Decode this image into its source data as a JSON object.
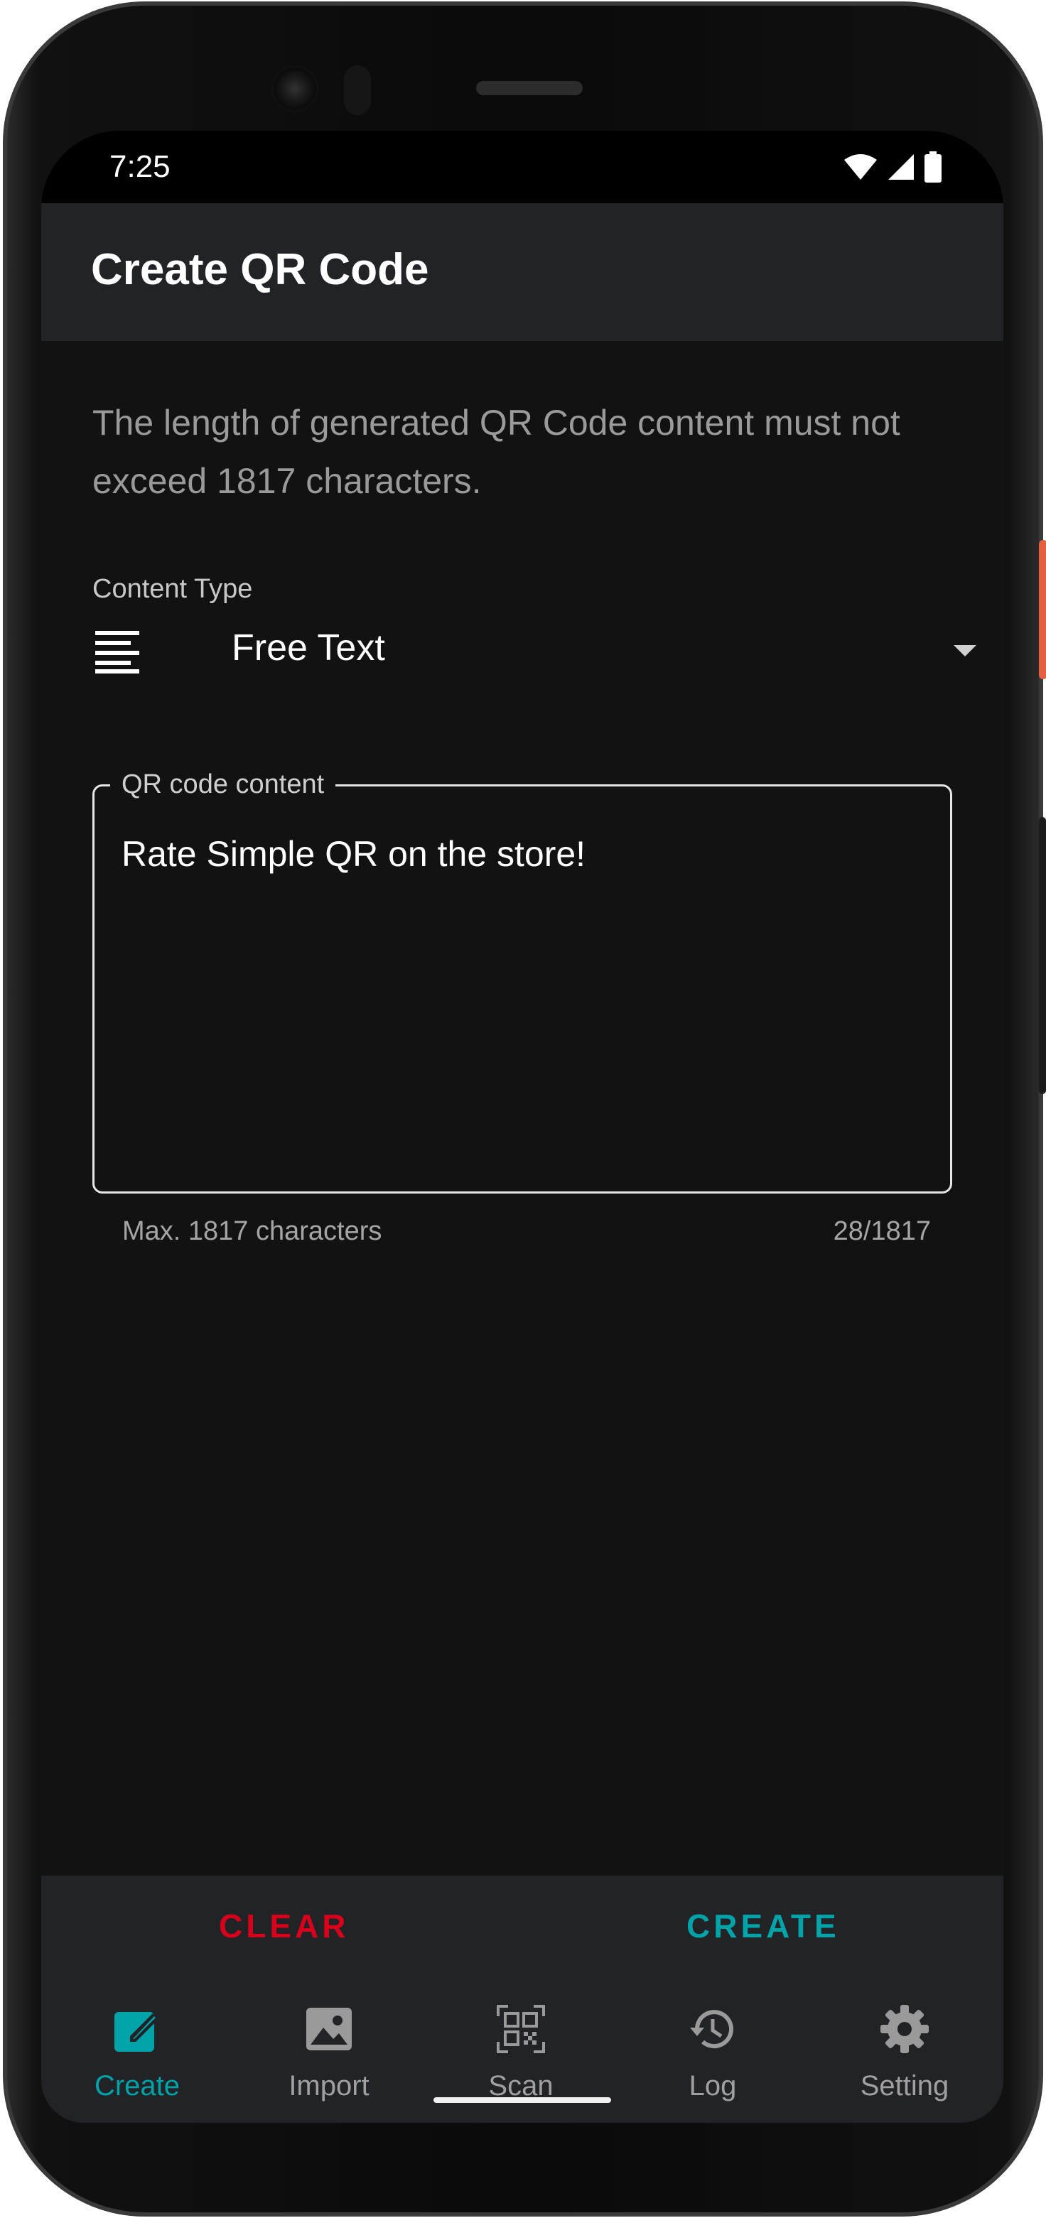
{
  "status_bar": {
    "time": "7:25",
    "icons": [
      "wifi-icon",
      "cell-signal-icon",
      "battery-icon"
    ]
  },
  "app_bar": {
    "title": "Create QR Code"
  },
  "info_text": "The length of generated QR Code content must not exceed 1817 characters.",
  "content_type": {
    "label": "Content Type",
    "selected": "Free Text",
    "icon": "text-lines-icon"
  },
  "qr_field": {
    "label": "QR code content",
    "value": "Rate Simple QR on the store!",
    "helper": "Max. 1817 characters",
    "counter": "28/1817"
  },
  "actions": {
    "clear_label": "CLEAR",
    "create_label": "CREATE"
  },
  "nav": {
    "items": [
      {
        "label": "Create",
        "icon": "edit-icon",
        "active": true
      },
      {
        "label": "Import",
        "icon": "image-icon",
        "active": false
      },
      {
        "label": "Scan",
        "icon": "qr-scan-icon",
        "active": false
      },
      {
        "label": "Log",
        "icon": "history-icon",
        "active": false
      },
      {
        "label": "Setting",
        "icon": "gear-icon",
        "active": false
      }
    ]
  },
  "colors": {
    "accent": "#00a3a8",
    "danger": "#d9001b",
    "background": "#121212",
    "surface": "#222327"
  }
}
